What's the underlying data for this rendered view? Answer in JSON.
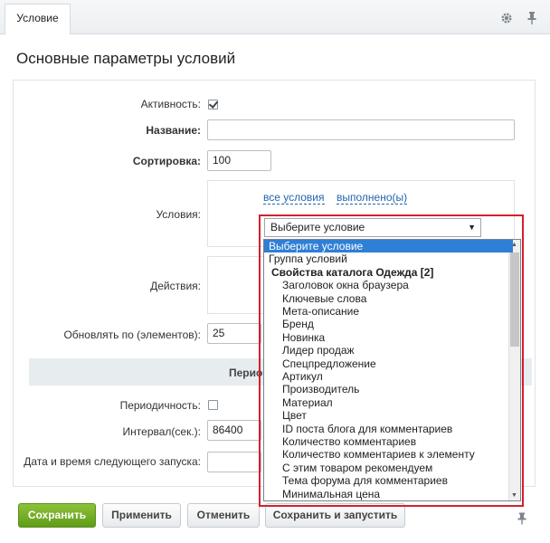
{
  "tab": {
    "label": "Условие"
  },
  "panel": {
    "title": "Основные параметры условий"
  },
  "form": {
    "active_label": "Активность:",
    "active_checked": true,
    "name_label": "Название:",
    "name_value": "",
    "sort_label": "Сортировка:",
    "sort_value": "100",
    "conditions_label": "Условия:",
    "conditions_links": [
      "все условия",
      "выполнено(ы)"
    ],
    "actions_label": "Действия:",
    "update_label": "Обновлять по (элементов):",
    "update_value": "25",
    "section_title": "Перио",
    "periodic_label": "Периодичность:",
    "periodic_checked": false,
    "interval_label": "Интервал(сек.):",
    "interval_value": "86400",
    "next_run_label": "Дата и время следующего запуска:",
    "next_run_value": ""
  },
  "dropdown": {
    "selected_value": "Выберите условие",
    "arrow": "▼",
    "options": [
      {
        "label": "Выберите условие",
        "selected": true,
        "indent": 0,
        "group": false
      },
      {
        "label": "Группа условий",
        "indent": 0,
        "group": false
      },
      {
        "label": "Свойства каталога Одежда [2]",
        "indent": 1,
        "group": true
      },
      {
        "label": "Заголовок окна браузера",
        "indent": 2,
        "group": false
      },
      {
        "label": "Ключевые слова",
        "indent": 2,
        "group": false
      },
      {
        "label": "Мета-описание",
        "indent": 2,
        "group": false
      },
      {
        "label": "Бренд",
        "indent": 2,
        "group": false
      },
      {
        "label": "Новинка",
        "indent": 2,
        "group": false
      },
      {
        "label": "Лидер продаж",
        "indent": 2,
        "group": false
      },
      {
        "label": "Спецпредложение",
        "indent": 2,
        "group": false
      },
      {
        "label": "Артикул",
        "indent": 2,
        "group": false
      },
      {
        "label": "Производитель",
        "indent": 2,
        "group": false
      },
      {
        "label": "Материал",
        "indent": 2,
        "group": false
      },
      {
        "label": "Цвет",
        "indent": 2,
        "group": false
      },
      {
        "label": "ID поста блога для комментариев",
        "indent": 2,
        "group": false
      },
      {
        "label": "Количество комментариев",
        "indent": 2,
        "group": false
      },
      {
        "label": "Количество комментариев к элементу",
        "indent": 2,
        "group": false
      },
      {
        "label": "С этим товаром рекомендуем",
        "indent": 2,
        "group": false
      },
      {
        "label": "Тема форума для комментариев",
        "indent": 2,
        "group": false
      },
      {
        "label": "Минимальная цена",
        "indent": 2,
        "group": false
      }
    ]
  },
  "buttons": {
    "save": "Сохранить",
    "apply": "Применить",
    "cancel": "Отменить",
    "save_run": "Сохранить и запустить"
  },
  "colors": {
    "accent": "#5f9c17",
    "link": "#2066b0",
    "highlight": "#d1212d",
    "selection": "#2f7fd6"
  }
}
